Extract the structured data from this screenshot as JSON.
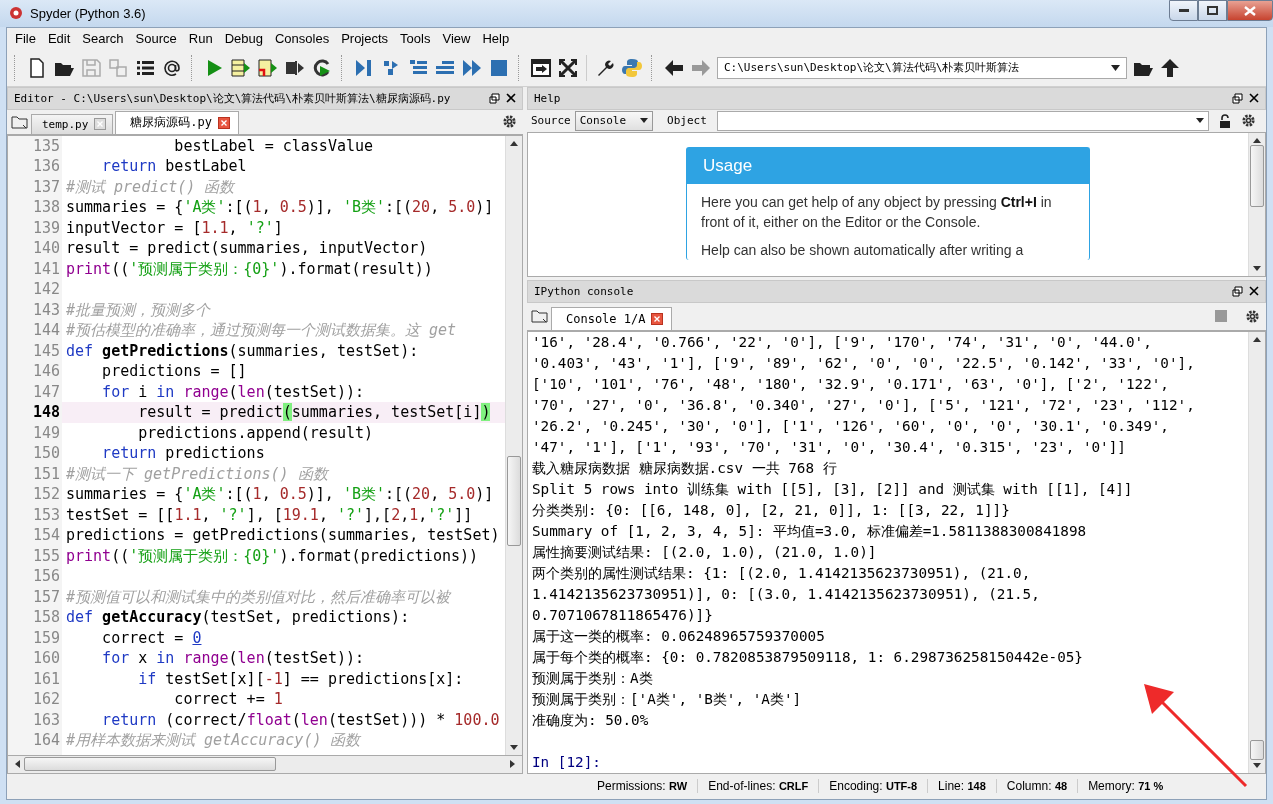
{
  "window": {
    "title": "Spyder (Python 3.6)"
  },
  "menu": [
    "File",
    "Edit",
    "Search",
    "Source",
    "Run",
    "Debug",
    "Consoles",
    "Projects",
    "Tools",
    "View",
    "Help"
  ],
  "path_field": {
    "value": "C:\\Users\\sun\\Desktop\\论文\\算法代码\\朴素贝叶斯算法"
  },
  "editor": {
    "title": "Editor - C:\\Users\\sun\\Desktop\\论文\\算法代码\\朴素贝叶斯算法\\糖尿病源码.py",
    "tabs": [
      {
        "label": "temp.py",
        "selected": false
      },
      {
        "label": "糖尿病源码.py",
        "selected": true
      }
    ],
    "lines": [
      {
        "number": "135",
        "current": false,
        "segments": [
          {
            "kind": "plain",
            "text": "            bestLabel = classValue"
          }
        ]
      },
      {
        "number": "136",
        "current": false,
        "segments": [
          {
            "kind": "keyword",
            "text": "    return"
          },
          {
            "kind": "plain",
            "text": " bestLabel"
          }
        ]
      },
      {
        "number": "137",
        "current": false,
        "segments": [
          {
            "kind": "comment",
            "text": "#测试 predict() 函数"
          }
        ]
      },
      {
        "number": "138",
        "current": false,
        "segments": [
          {
            "kind": "plain",
            "text": "summaries = {"
          },
          {
            "kind": "string",
            "text": "'A类'"
          },
          {
            "kind": "plain",
            "text": ":[("
          },
          {
            "kind": "number",
            "text": "1"
          },
          {
            "kind": "plain",
            "text": ", "
          },
          {
            "kind": "number",
            "text": "0.5"
          },
          {
            "kind": "plain",
            "text": ")], "
          },
          {
            "kind": "string",
            "text": "'B类'"
          },
          {
            "kind": "plain",
            "text": ":[("
          },
          {
            "kind": "number",
            "text": "20"
          },
          {
            "kind": "plain",
            "text": ", "
          },
          {
            "kind": "number",
            "text": "5.0"
          },
          {
            "kind": "plain",
            "text": ")]"
          }
        ]
      },
      {
        "number": "139",
        "current": false,
        "segments": [
          {
            "kind": "plain",
            "text": "inputVector = ["
          },
          {
            "kind": "number",
            "text": "1.1"
          },
          {
            "kind": "plain",
            "text": ", "
          },
          {
            "kind": "string",
            "text": "'?'"
          },
          {
            "kind": "plain",
            "text": "]"
          }
        ]
      },
      {
        "number": "140",
        "current": false,
        "segments": [
          {
            "kind": "plain",
            "text": "result = predict(summaries, inputVector)"
          }
        ]
      },
      {
        "number": "141",
        "current": false,
        "segments": [
          {
            "kind": "builtin",
            "text": "print"
          },
          {
            "kind": "plain",
            "text": "(("
          },
          {
            "kind": "string",
            "text": "'预测属于类别：{0}'"
          },
          {
            "kind": "plain",
            "text": ").format(result))"
          }
        ]
      },
      {
        "number": "142",
        "current": false
      },
      {
        "number": "143",
        "current": false,
        "segments": [
          {
            "kind": "comment",
            "text": "#批量预测，预测多个"
          }
        ]
      },
      {
        "number": "144",
        "current": false,
        "segments": [
          {
            "kind": "comment",
            "text": "#预估模型的准确率，通过预测每一个测试数据集。这 get"
          }
        ]
      },
      {
        "number": "145",
        "current": false,
        "segments": [
          {
            "kind": "keyword",
            "text": "def"
          },
          {
            "kind": "definition",
            "text": " getPredictions"
          },
          {
            "kind": "plain",
            "text": "(summaries, testSet):"
          }
        ]
      },
      {
        "number": "146",
        "current": false,
        "segments": [
          {
            "kind": "plain",
            "text": "    predictions = []"
          }
        ]
      },
      {
        "number": "147",
        "current": false,
        "segments": [
          {
            "kind": "keyword",
            "text": "    for"
          },
          {
            "kind": "plain",
            "text": " i "
          },
          {
            "kind": "keyword",
            "text": "in"
          },
          {
            "kind": "builtin",
            "text": " range"
          },
          {
            "kind": "plain",
            "text": "("
          },
          {
            "kind": "builtin",
            "text": "len"
          },
          {
            "kind": "plain",
            "text": "(testSet)):"
          }
        ]
      },
      {
        "number": "148",
        "current": true,
        "segments": [
          {
            "kind": "plain",
            "text": "        result = predict"
          },
          {
            "kind": "match",
            "text": "("
          },
          {
            "kind": "plain",
            "text": "summaries, testSet[i]"
          },
          {
            "kind": "match",
            "text": ")"
          }
        ]
      },
      {
        "number": "149",
        "current": false,
        "segments": [
          {
            "kind": "plain",
            "text": "        predictions.append(result)"
          }
        ]
      },
      {
        "number": "150",
        "current": false,
        "segments": [
          {
            "kind": "keyword",
            "text": "    return"
          },
          {
            "kind": "plain",
            "text": " predictions"
          }
        ]
      },
      {
        "number": "151",
        "current": false,
        "segments": [
          {
            "kind": "comment",
            "text": "#测试一下 getPredictions() 函数"
          }
        ]
      },
      {
        "number": "152",
        "current": false,
        "segments": [
          {
            "kind": "plain",
            "text": "summaries = {"
          },
          {
            "kind": "string",
            "text": "'A类'"
          },
          {
            "kind": "plain",
            "text": ":[("
          },
          {
            "kind": "number",
            "text": "1"
          },
          {
            "kind": "plain",
            "text": ", "
          },
          {
            "kind": "number",
            "text": "0.5"
          },
          {
            "kind": "plain",
            "text": ")], "
          },
          {
            "kind": "string",
            "text": "'B类'"
          },
          {
            "kind": "plain",
            "text": ":[("
          },
          {
            "kind": "number",
            "text": "20"
          },
          {
            "kind": "plain",
            "text": ", "
          },
          {
            "kind": "number",
            "text": "5.0"
          },
          {
            "kind": "plain",
            "text": ")]"
          }
        ]
      },
      {
        "number": "153",
        "current": false,
        "segments": [
          {
            "kind": "plain",
            "text": "testSet = [["
          },
          {
            "kind": "number",
            "text": "1.1"
          },
          {
            "kind": "plain",
            "text": ", "
          },
          {
            "kind": "string",
            "text": "'?'"
          },
          {
            "kind": "plain",
            "text": "], ["
          },
          {
            "kind": "number",
            "text": "19.1"
          },
          {
            "kind": "plain",
            "text": ", "
          },
          {
            "kind": "string",
            "text": "'?'"
          },
          {
            "kind": "plain",
            "text": "],["
          },
          {
            "kind": "number",
            "text": "2"
          },
          {
            "kind": "plain",
            "text": ","
          },
          {
            "kind": "number",
            "text": "1"
          },
          {
            "kind": "plain",
            "text": ","
          },
          {
            "kind": "string",
            "text": "'?'"
          },
          {
            "kind": "plain",
            "text": "]]"
          }
        ]
      },
      {
        "number": "154",
        "current": false,
        "segments": [
          {
            "kind": "plain",
            "text": "predictions = getPredictions(summaries, testSet)"
          }
        ]
      },
      {
        "number": "155",
        "current": false,
        "segments": [
          {
            "kind": "builtin",
            "text": "print"
          },
          {
            "kind": "plain",
            "text": "(("
          },
          {
            "kind": "string",
            "text": "'预测属于类别：{0}'"
          },
          {
            "kind": "plain",
            "text": ").format(predictions))"
          }
        ]
      },
      {
        "number": "156",
        "current": false
      },
      {
        "number": "157",
        "current": false,
        "segments": [
          {
            "kind": "comment",
            "text": "#预测值可以和测试集中的类别值对比，然后准确率可以被"
          }
        ]
      },
      {
        "number": "158",
        "current": false,
        "segments": [
          {
            "kind": "keyword",
            "text": "def"
          },
          {
            "kind": "definition",
            "text": " getAccuracy"
          },
          {
            "kind": "plain",
            "text": "(testSet, predictions):"
          }
        ]
      },
      {
        "number": "159",
        "current": false,
        "segments": [
          {
            "kind": "plain",
            "text": "    correct = "
          },
          {
            "kind": "link",
            "text": "0"
          }
        ]
      },
      {
        "number": "160",
        "current": false,
        "segments": [
          {
            "kind": "keyword",
            "text": "    for"
          },
          {
            "kind": "plain",
            "text": " x "
          },
          {
            "kind": "keyword",
            "text": "in"
          },
          {
            "kind": "builtin",
            "text": " range"
          },
          {
            "kind": "plain",
            "text": "("
          },
          {
            "kind": "builtin",
            "text": "len"
          },
          {
            "kind": "plain",
            "text": "(testSet)):"
          }
        ]
      },
      {
        "number": "161",
        "current": false,
        "segments": [
          {
            "kind": "keyword",
            "text": "        if"
          },
          {
            "kind": "plain",
            "text": " testSet[x]["
          },
          {
            "kind": "number",
            "text": "-1"
          },
          {
            "kind": "plain",
            "text": "] == predictions[x]:"
          }
        ]
      },
      {
        "number": "162",
        "current": false,
        "segments": [
          {
            "kind": "plain",
            "text": "            correct += "
          },
          {
            "kind": "number",
            "text": "1"
          }
        ]
      },
      {
        "number": "163",
        "current": false,
        "segments": [
          {
            "kind": "keyword",
            "text": "    return"
          },
          {
            "kind": "plain",
            "text": " (correct/"
          },
          {
            "kind": "builtin",
            "text": "float"
          },
          {
            "kind": "plain",
            "text": "("
          },
          {
            "kind": "builtin",
            "text": "len"
          },
          {
            "kind": "plain",
            "text": "(testSet))) * "
          },
          {
            "kind": "number",
            "text": "100.0"
          }
        ]
      },
      {
        "number": "164",
        "current": false,
        "segments": [
          {
            "kind": "comment",
            "text": "#用样本数据来测试 getAccuracy() 函数"
          }
        ]
      }
    ]
  },
  "help": {
    "title": "Help",
    "source_label": "Source",
    "source_value": "Console",
    "object_label": "Object",
    "card_title": "Usage",
    "paragraphs": [
      "Here you can get help of any object by pressing **Ctrl+I** in front of it, either on the Editor or the Console.",
      "Help can also be shown automatically after writing a"
    ]
  },
  "console": {
    "title": "IPython console",
    "tabs": [
      {
        "label": "Console 1/A",
        "selected": true
      }
    ],
    "lines": [
      "'16', '28.4', '0.766', '22', '0'], ['9', '170', '74', '31', '0', '44.0',",
      "'0.403', '43', '1'], ['9', '89', '62', '0', '0', '22.5', '0.142', '33', '0'],",
      "['10', '101', '76', '48', '180', '32.9', '0.171', '63', '0'], ['2', '122',",
      "'70', '27', '0', '36.8', '0.340', '27', '0'], ['5', '121', '72', '23', '112',",
      "'26.2', '0.245', '30', '0'], ['1', '126', '60', '0', '0', '30.1', '0.349',",
      "'47', '1'], ['1', '93', '70', '31', '0', '30.4', '0.315', '23', '0']]",
      "载入糖尿病数据 糖尿病数据.csv 一共 768 行",
      "Split 5 rows into 训练集 with [[5], [3], [2]] and 测试集 with [[1], [4]]",
      "分类类别: {0: [[6, 148, 0], [2, 21, 0]], 1: [[3, 22, 1]]}",
      "Summary of [1, 2, 3, 4, 5]: 平均值=3.0, 标准偏差=1.5811388300841898",
      "属性摘要测试结果: [(2.0, 1.0), (21.0, 1.0)]",
      "两个类别的属性测试结果: {1: [(2.0, 1.4142135623730951), (21.0,",
      "1.4142135623730951)], 0: [(3.0, 1.4142135623730951), (21.5,",
      "0.7071067811865476)]}",
      "属于这一类的概率: 0.06248965759370005",
      "属于每个类的概率: {0: 0.7820853879509118, 1: 6.298736258150442e-05}",
      "预测属于类别：A类",
      "预测属于类别：['A类', 'B类', 'A类']",
      "准确度为: 50.0%"
    ],
    "prompt": "In [12]:"
  },
  "status_bar": [
    {
      "label": "Permissions:",
      "value": "RW"
    },
    {
      "label": "End-of-lines:",
      "value": "CRLF"
    },
    {
      "label": "Encoding:",
      "value": "UTF-8"
    },
    {
      "label": "Line:",
      "value": "148"
    },
    {
      "label": "Column:",
      "value": "48"
    },
    {
      "label": "Memory:",
      "value": "71 %"
    }
  ]
}
